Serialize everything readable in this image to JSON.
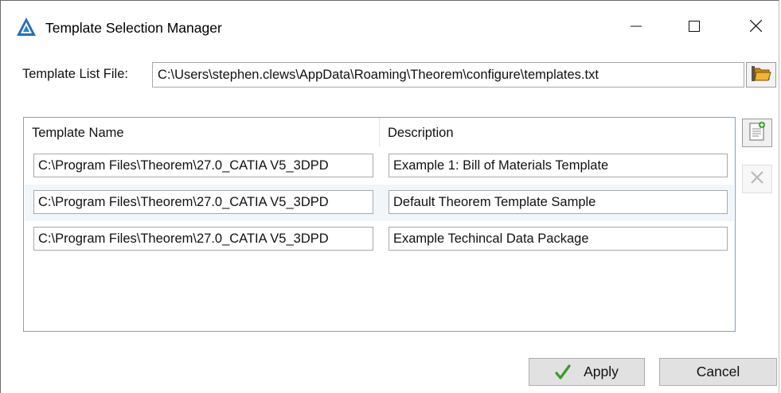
{
  "window": {
    "title": "Template Selection Manager",
    "icon": "theorem-triangle-icon",
    "controls": {
      "minimize": "minimize-icon",
      "maximize": "maximize-icon",
      "close": "close-icon"
    }
  },
  "file": {
    "label": "Template List File:",
    "value": "C:\\Users\\stephen.clews\\AppData\\Roaming\\Theorem\\configure\\templates.txt",
    "browse_icon": "folder-open-icon"
  },
  "grid": {
    "columns": [
      "Template Name",
      "Description"
    ],
    "rows": [
      {
        "name": "C:\\Program Files\\Theorem\\27.0_CATIA V5_3DPD",
        "description": "Example 1: Bill of Materials Template"
      },
      {
        "name": "C:\\Program Files\\Theorem\\27.0_CATIA V5_3DPD",
        "description": "Default Theorem Template Sample"
      },
      {
        "name": "C:\\Program Files\\Theorem\\27.0_CATIA V5_3DPD",
        "description": "Example Techincal Data Package"
      }
    ]
  },
  "side_actions": {
    "add_icon": "add-document-icon",
    "remove_icon": "remove-x-icon"
  },
  "buttons": {
    "apply": "Apply",
    "cancel": "Cancel",
    "apply_icon": "checkmark-icon"
  },
  "colors": {
    "accent_border": "#7da2ce",
    "alt_row": "#f1f6fb",
    "check_green": "#3a9a2a"
  }
}
